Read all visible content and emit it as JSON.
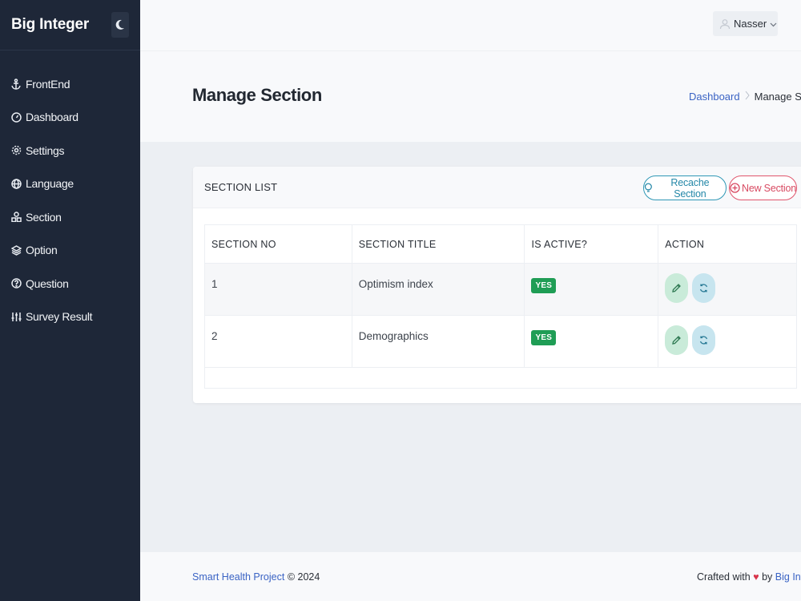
{
  "sidebar": {
    "brand": "Big Integer",
    "items": [
      {
        "label": "FrontEnd",
        "icon": "anchor-icon"
      },
      {
        "label": "Dashboard",
        "icon": "gauge-icon"
      },
      {
        "label": "Settings",
        "icon": "gear-icon"
      },
      {
        "label": "Language",
        "icon": "globe-icon"
      },
      {
        "label": "Section",
        "icon": "shapes-icon"
      },
      {
        "label": "Option",
        "icon": "layers-icon"
      },
      {
        "label": "Question",
        "icon": "question-icon"
      },
      {
        "label": "Survey Result",
        "icon": "sliders-icon"
      }
    ]
  },
  "topbar": {
    "user_name": "Nasser"
  },
  "header": {
    "title": "Manage Section",
    "breadcrumb": {
      "link": "Dashboard",
      "current": "Manage Section"
    }
  },
  "card": {
    "title": "SECTION LIST",
    "recache_label": "Recache Section",
    "new_label": "New Section"
  },
  "table": {
    "headers": [
      "SECTION NO",
      "SECTION TITLE",
      "IS ACTIVE?",
      "ACTION"
    ],
    "rows": [
      {
        "no": "1",
        "title": "Optimism index",
        "active": "YES"
      },
      {
        "no": "2",
        "title": "Demographics",
        "active": "YES"
      }
    ]
  },
  "footer": {
    "project": "Smart Health Project",
    "year": "© 2024",
    "crafted": "Crafted with",
    "by": "by",
    "author": "Big Integer"
  },
  "colors": {
    "sidebar_bg": "#1e2738",
    "accent_link": "#3a63c4",
    "success": "#1f9d55",
    "recache": "#2e97b5",
    "new": "#e0556c"
  }
}
